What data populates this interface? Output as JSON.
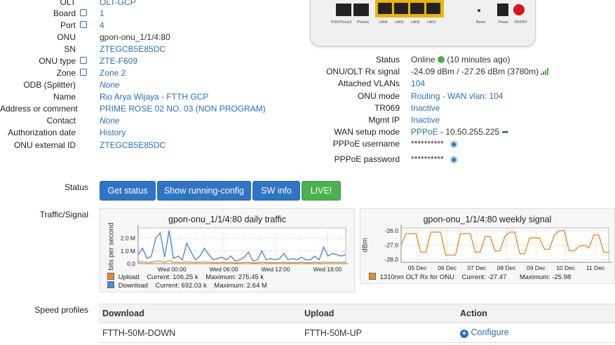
{
  "left_fields": [
    {
      "label": "OLT",
      "value": "OLT-GCP",
      "link": true,
      "icon": false
    },
    {
      "label": "Board",
      "value": "1",
      "link": true,
      "icon": true
    },
    {
      "label": "Port",
      "value": "4",
      "link": true,
      "icon": true
    },
    {
      "label": "ONU",
      "value": "gpon-onu_1/1/4:80",
      "link": false,
      "icon": false
    },
    {
      "label": "SN",
      "value": "ZTEGCB5E85DC",
      "link": true,
      "icon": false
    },
    {
      "label": "ONU type",
      "value": "ZTE-F609",
      "link": true,
      "icon": true
    },
    {
      "label": "Zone",
      "value": "Zone 2",
      "link": true,
      "icon": true
    },
    {
      "label": "ODB (Splitter)",
      "value": "None",
      "link": true,
      "icon": false,
      "italic": true
    },
    {
      "label": "Name",
      "value": "Rio Arya Wijaya - FTTH GCP",
      "link": true,
      "icon": false
    },
    {
      "label": "Address or comment",
      "value": "PRIME ROSE 02 NO. 03 (NON PROGRAM)",
      "link": true,
      "icon": false
    },
    {
      "label": "Contact",
      "value": "None",
      "link": true,
      "icon": false,
      "italic": true
    },
    {
      "label": "Authorization date",
      "value": "History",
      "link": true,
      "icon": false
    },
    {
      "label": "ONU external ID",
      "value": "ZTEGCB5E85DC",
      "link": true,
      "icon": false
    }
  ],
  "device_image": {
    "port_labels": [
      "PON",
      "Phone2",
      "Phone1",
      "LAN4",
      "LAN3",
      "LAN2",
      "LAN1",
      "Reset",
      "Power",
      "ON/OFF"
    ]
  },
  "right_fields": {
    "status": {
      "label": "Status",
      "value": "Online",
      "suffix": "(10 minutes ago)"
    },
    "rx": {
      "label": "ONU/OLT Rx signal",
      "value": "-24.09 dBm / -27.26 dBm (3780m)"
    },
    "vlans": {
      "label": "Attached VLANs",
      "value": "104"
    },
    "mode": {
      "label": "ONU mode",
      "value": "Routing - WAN vlan: 104"
    },
    "tr069": {
      "label": "TR069",
      "value": "Inactive"
    },
    "mgmt": {
      "label": "Mgmt IP",
      "value": "Inactive"
    },
    "wan": {
      "label": "WAN setup mode",
      "value": "PPPoE",
      "suffix": "- 10.50.255.225"
    },
    "pppoe_user": {
      "label": "PPPoE username",
      "value": "**********"
    },
    "pppoe_pass": {
      "label": "PPPoE password",
      "value": "**********"
    }
  },
  "status_section": {
    "label": "Status",
    "buttons": [
      "Get status",
      "Show running-config",
      "SW info",
      "LIVE!"
    ]
  },
  "traffic_section": {
    "label": "Traffic/Signal"
  },
  "traffic_chart": {
    "title": "gpon-onu_1/1/4:80 daily traffic",
    "ylabel": "bits per second",
    "yticks": [
      "2.0 M",
      "1.0 M",
      "0.0"
    ],
    "xticks": [
      "Wed 00:00",
      "Wed 06:00",
      "Wed 12:00",
      "Wed 18:00"
    ],
    "legend": [
      {
        "name": "Upload",
        "current": "Current:   106.25 k",
        "max": "Maximum:   275.45 k",
        "color": "#f08a24"
      },
      {
        "name": "Download",
        "current": "Current:   692.03 k",
        "max": "Maximum:     2.64 M",
        "color": "#4a8ae0"
      }
    ]
  },
  "signal_chart": {
    "title": "gpon-onu_1/1/4:80 weekly signal",
    "ylabel": "dBm",
    "yticks": [
      "-26.0",
      "-27.0",
      "-28.0"
    ],
    "xticks": [
      "05 Dec",
      "06 Dec",
      "07 Dec",
      "08 Dec",
      "09 Dec",
      "10 Dec",
      "11 Dec"
    ],
    "legend": {
      "name": "1310nm OLT Rx for ONU",
      "current": "Current:   -27.47",
      "max": "Maximum:   -25.98",
      "color": "#f08a24"
    }
  },
  "chart_data": [
    {
      "type": "line",
      "title": "gpon-onu_1/1/4:80 daily traffic",
      "ylabel": "bits per second",
      "ylim": [
        0,
        2.8
      ],
      "unit": "M",
      "series": [
        {
          "name": "Download",
          "values": [
            0.7,
            1.2,
            0.4,
            0.6,
            2.0,
            2.4,
            0.5,
            2.6,
            0.4,
            0.6,
            0.3,
            1.6,
            0.9,
            0.3,
            0.6,
            1.2,
            0.7,
            0.3,
            0.4,
            0.5,
            0.3,
            0.6,
            0.2,
            0.3,
            0.5,
            0.9,
            0.2,
            0.3,
            1.0,
            0.3,
            0.4,
            0.3,
            0.4,
            0.8,
            0.3,
            0.4,
            0.3,
            0.5,
            0.3,
            0.3,
            0.6,
            0.3,
            1.3,
            0.6,
            0.8,
            0.7,
            0.6,
            0.7
          ]
        },
        {
          "name": "Upload",
          "values": [
            0.1,
            0.15,
            0.1,
            0.1,
            0.2,
            0.2,
            0.1,
            0.25,
            0.1,
            0.1,
            0.1,
            0.15,
            0.1,
            0.1,
            0.1,
            0.12,
            0.1,
            0.08,
            0.08,
            0.1,
            0.08,
            0.1,
            0.06,
            0.08,
            0.1,
            0.1,
            0.06,
            0.08,
            0.12,
            0.08,
            0.08,
            0.08,
            0.08,
            0.1,
            0.08,
            0.08,
            0.08,
            0.1,
            0.08,
            0.08,
            0.1,
            0.08,
            0.12,
            0.1,
            0.1,
            0.1,
            0.1,
            0.1
          ]
        }
      ]
    },
    {
      "type": "line",
      "title": "gpon-onu_1/1/4:80 weekly signal",
      "ylabel": "dBm",
      "ylim": [
        -28.2,
        -25.8
      ],
      "series": [
        {
          "name": "1310nm OLT Rx for ONU",
          "values": [
            -27.0,
            -26.2,
            -26.2,
            -26.2,
            -27.5,
            -27.5,
            -26.1,
            -26.1,
            -26.1,
            -27.7,
            -27.7,
            -27.7,
            -26.2,
            -26.2,
            -26.2,
            -27.5,
            -27.5,
            -26.4,
            -26.4,
            -27.4,
            -27.4,
            -26.4,
            -26.1,
            -26.1,
            -27.6,
            -27.6,
            -26.5,
            -26.5,
            -26.5,
            -27.3,
            -27.3,
            -26.3,
            -26.0,
            -26.0,
            -27.4,
            -27.4,
            -27.1,
            -27.0,
            -27.2,
            -26.3,
            -26.3,
            -27.5,
            -27.5
          ]
        }
      ]
    }
  ],
  "speed_profiles": {
    "label": "Speed profiles",
    "headers": [
      "Download",
      "Upload",
      "Action"
    ],
    "rows": [
      {
        "download": "FTTH-50M-DOWN",
        "upload": "FTTH-50M-UP",
        "action": "Configure"
      }
    ]
  },
  "colors": {
    "link": "#2a6ebb",
    "button_blue": "#2f74c6",
    "button_green": "#4caf50",
    "online": "#4caf50"
  }
}
